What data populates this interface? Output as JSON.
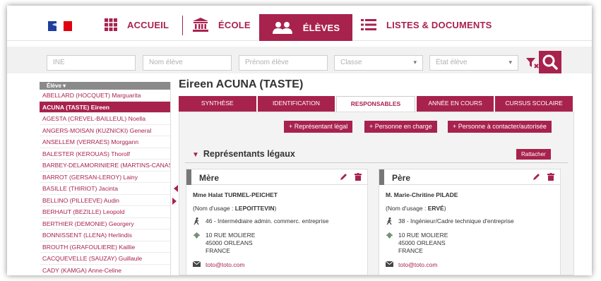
{
  "nav": {
    "accueil": "ACCUEIL",
    "ecole": "ÉCOLE",
    "eleves": "ÉLÈVES",
    "listes": "LISTES & DOCUMENTS"
  },
  "filters": {
    "ine": "INE",
    "nom": "Nom élève",
    "prenom": "Prénom élève",
    "classe": "Classe",
    "etat": "État élève"
  },
  "list": {
    "header": "Élève",
    "items": [
      "ABELLARD (HOCQUET) Marguarita",
      "ACUNA (TASTE) Eireen",
      "AGESTA (CREVEL-BAILLEUL) Noella",
      "ANGERS-MOISAN (KUZNICKI) General",
      "ANSELLEM (VERRAES) Morggann",
      "BALESTER (KEROUAS) Thorolf",
      "BARBEY-DELAMORINIERE (MARTINS-CANAS) J",
      "BARROT (GERSAN-LEROY) Lainy",
      "BASILLE (THIRIOT) Jacinta",
      "BELLINO (PILLEEVE) Audin",
      "BERHAUT (BEZILLE) Leopold",
      "BERTHIER (DEMONIE) Georgery",
      "BONNISSENT (LLENA) Herlindis",
      "BROUTH (GRAFOULIERE) Kaillie",
      "CACQUEVELLE (SAUZAY) Guillaule",
      "CADY (KAMGA) Anne-Celine"
    ],
    "selected_index": 1
  },
  "student": {
    "title": "Eireen ACUNA (TASTE)"
  },
  "tabs": [
    "SYNTHÈSE",
    "IDENTIFICATION",
    "RESPONSABLES",
    "ANNÉE EN COURS",
    "CURSUS SCOLAIRE"
  ],
  "active_tab": "RESPONSABLES",
  "actions": {
    "legal": "+  Représentant légal",
    "charge": "+  Personne en charge",
    "contact": "+  Personne à contacter/autorisée"
  },
  "section": {
    "title": "Représentants légaux",
    "rattacher": "Rattacher"
  },
  "cards": [
    {
      "title": "Mère",
      "name": "Mme Halat TURMEL-PEICHET",
      "usage_prefix": "(Nom d'usage : ",
      "usage_name": "LEPOITTEVIN",
      "usage_suffix": ")",
      "profession": "46 - Intermédiaire admin. commerc. entreprise",
      "address1": "10 RUE MOLIERE",
      "address2": "45000 ORLEANS",
      "address3": "FRANCE",
      "email": "toto@toto.com"
    },
    {
      "title": "Père",
      "name": "M. Marie-Chritine PILADE",
      "usage_prefix": "(Nom d'usage : ",
      "usage_name": "ERVÉ",
      "usage_suffix": ")",
      "profession": "38 - Ingénieur/Cadre technique d'entreprise",
      "address1": "10 RUE MOLIERE",
      "address2": "45000 ORLEANS",
      "address3": "FRANCE",
      "email": "toto@toto.com"
    }
  ],
  "colors": {
    "accent": "#a8224e",
    "flag_blue": "#1f3e9c",
    "flag_red": "#e1000f"
  }
}
